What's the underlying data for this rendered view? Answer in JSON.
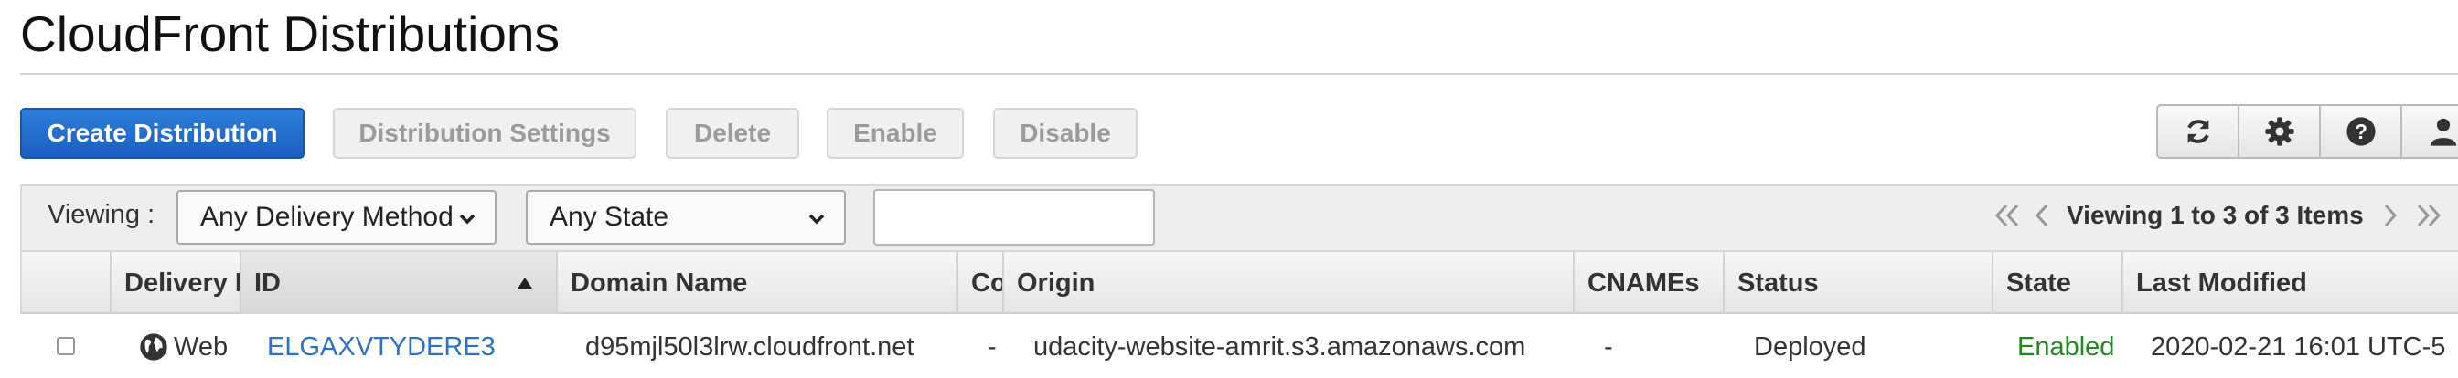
{
  "page": {
    "title": "CloudFront Distributions"
  },
  "toolbar": {
    "create_label": "Create Distribution",
    "settings_label": "Distribution Settings",
    "delete_label": "Delete",
    "enable_label": "Enable",
    "disable_label": "Disable",
    "icons": [
      "refresh-icon",
      "gear-icon",
      "help-icon",
      "user-icon"
    ]
  },
  "filters": {
    "viewing_label": "Viewing :",
    "delivery_method": "Any Delivery Method",
    "state": "Any State",
    "search_value": ""
  },
  "pagination": {
    "summary": "Viewing 1 to 3 of 3 Items"
  },
  "table": {
    "columns": {
      "delivery": "Delivery Method",
      "id": "ID",
      "domain": "Domain Name",
      "comment": "Comment",
      "origin": "Origin",
      "cnames": "CNAMEs",
      "status": "Status",
      "state": "State",
      "modified": "Last Modified"
    },
    "rows": [
      {
        "delivery": "Web",
        "id": "ELGAXVTYDERE3",
        "domain": "d95mjl50l3lrw.cloudfront.net",
        "comment": "-",
        "origin": "udacity-website-amrit.s3.amazonaws.com",
        "cnames": "-",
        "status": "Deployed",
        "state": "Enabled",
        "modified": "2020-02-21 16:01 UTC-5"
      }
    ]
  },
  "colors": {
    "primary": "#1b5fbf",
    "link": "#2a73c7",
    "enabled": "#1d8a1d"
  }
}
